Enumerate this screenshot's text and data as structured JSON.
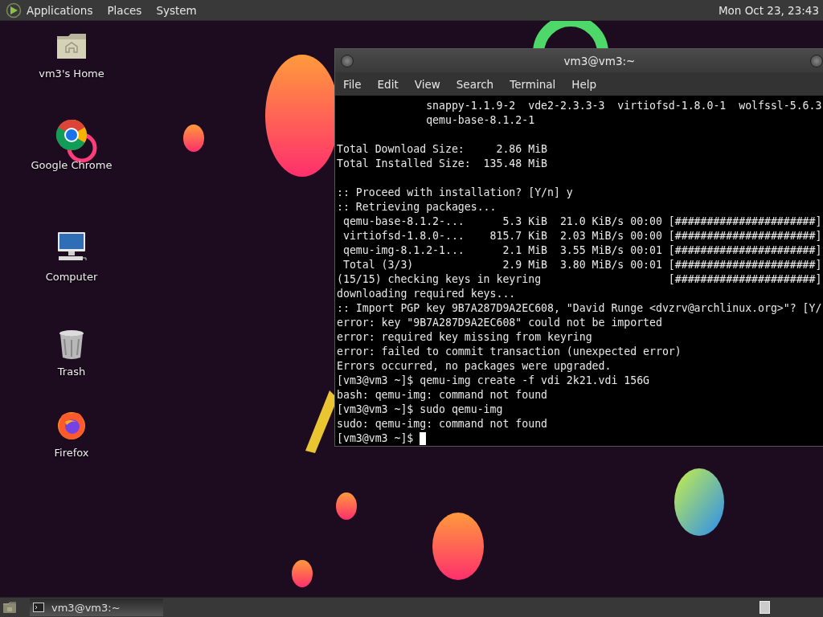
{
  "top_panel": {
    "menus": [
      "Applications",
      "Places",
      "System"
    ],
    "clock": "Mon Oct 23, 23:43"
  },
  "desktop_icons": [
    {
      "kind": "home",
      "label": "vm3's Home"
    },
    {
      "kind": "chrome",
      "label": "Google Chrome"
    },
    {
      "kind": "computer",
      "label": "Computer"
    },
    {
      "kind": "trash",
      "label": "Trash"
    },
    {
      "kind": "firefox",
      "label": "Firefox"
    }
  ],
  "terminal_window": {
    "title": "vm3@vm3:~",
    "menus": [
      "File",
      "Edit",
      "View",
      "Search",
      "Terminal",
      "Help"
    ],
    "blocks": [
      [
        "              snappy-1.1.9-2  vde2-2.3.3-3  virtiofsd-1.8.0-1  wolfssl-5.6.3",
        "              qemu-base-8.1.2-1"
      ],
      [
        "Total Download Size:     2.86 MiB",
        "Total Installed Size:  135.48 MiB"
      ],
      [
        ":: Proceed with installation? [Y/n] y",
        ":: Retrieving packages...",
        " qemu-base-8.1.2-...      5.3 KiB  21.0 KiB/s 00:00 [######################]",
        " virtiofsd-1.8.0-...    815.7 KiB  2.03 MiB/s 00:00 [######################]",
        " qemu-img-8.1.2-1...      2.1 MiB  3.55 MiB/s 00:01 [######################]",
        " Total (3/3)              2.9 MiB  3.80 MiB/s 00:01 [######################]",
        "(15/15) checking keys in keyring                    [######################]",
        "downloading required keys...",
        ":: Import PGP key 9B7A287D9A2EC608, \"David Runge <dvzrv@archlinux.org>\"? [Y/",
        "error: key \"9B7A287D9A2EC608\" could not be imported",
        "error: required key missing from keyring",
        "error: failed to commit transaction (unexpected error)",
        "Errors occurred, no packages were upgraded.",
        "[vm3@vm3 ~]$ qemu-img create -f vdi 2k21.vdi 156G",
        "bash: qemu-img: command not found",
        "[vm3@vm3 ~]$ sudo qemu-img",
        "sudo: qemu-img: command not found",
        "[vm3@vm3 ~]$ "
      ]
    ],
    "cursor_visible": true
  },
  "bottom_panel": {
    "tasks": [
      {
        "label": "vm3@vm3:~",
        "selected": true
      }
    ]
  }
}
